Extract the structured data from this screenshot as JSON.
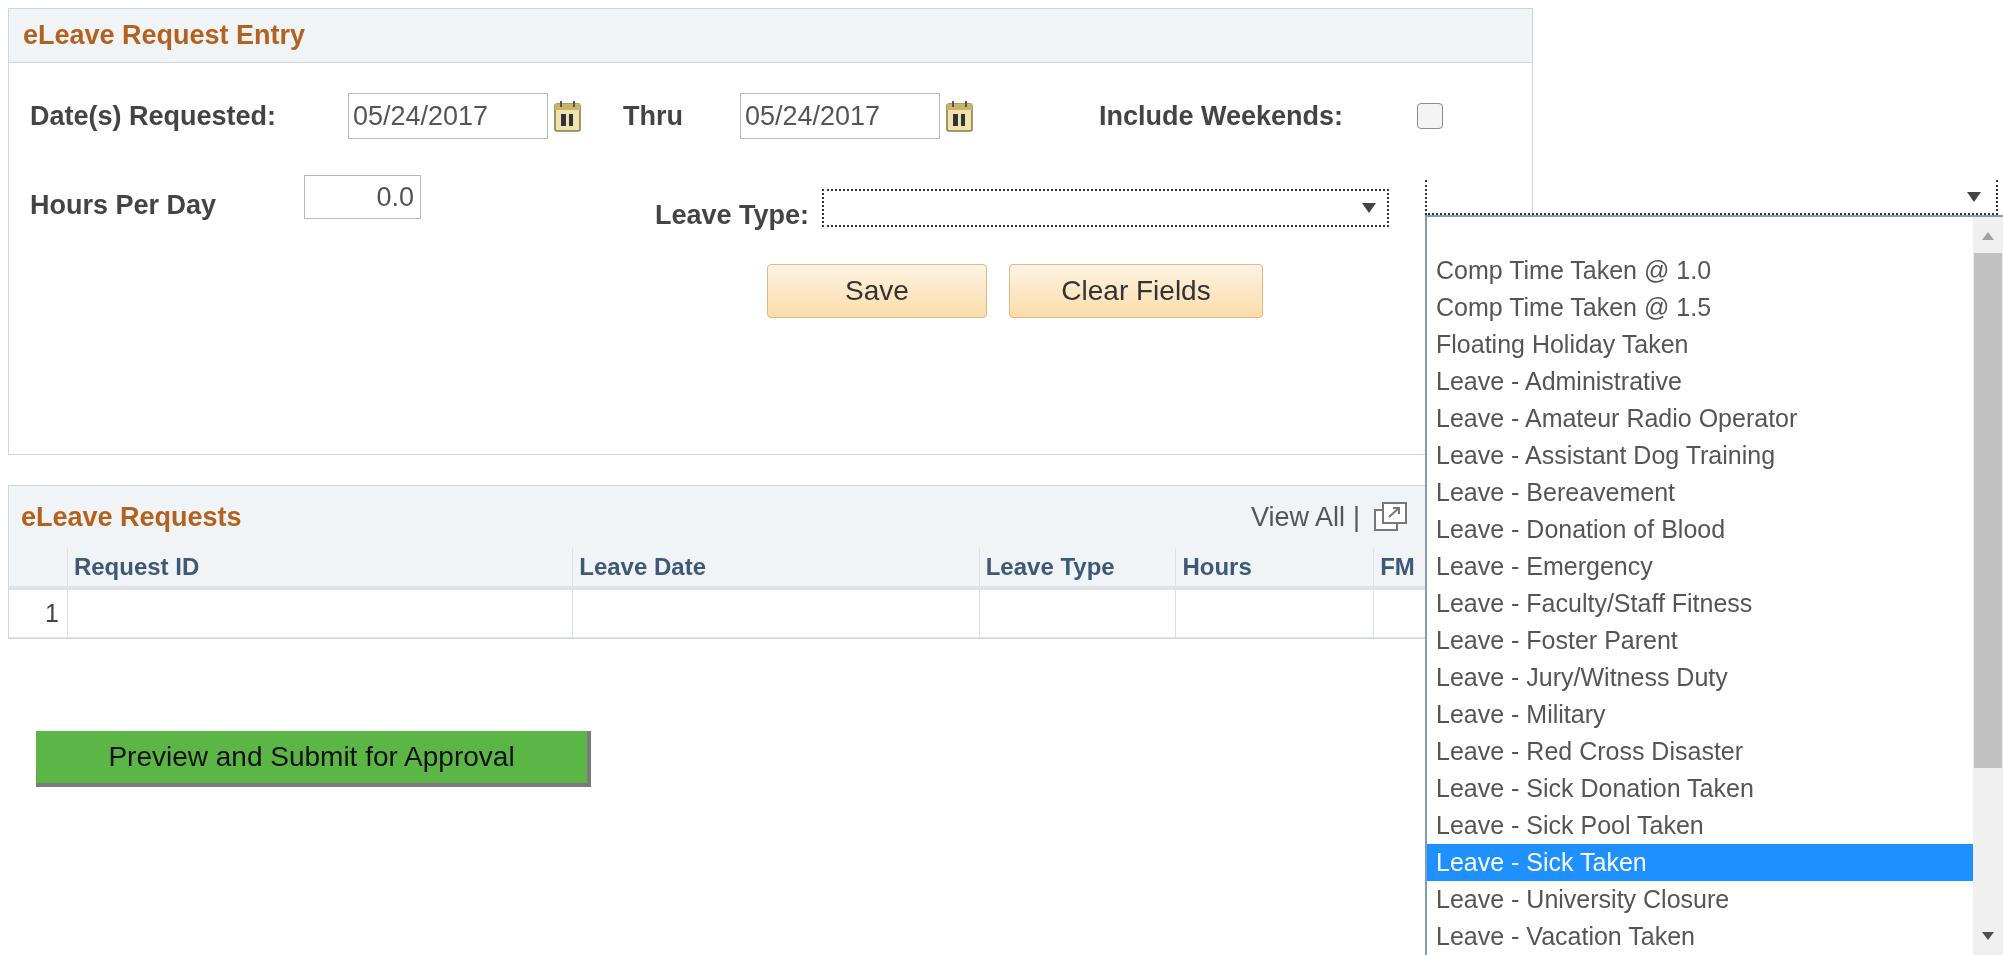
{
  "entry_panel": {
    "title": "eLeave Request Entry",
    "dates_requested": {
      "label": "Date(s) Requested:",
      "value": "05/24/2017"
    },
    "thru": {
      "label": "Thru",
      "value": "05/24/2017"
    },
    "include_weekends": {
      "label": "Include Weekends:",
      "checked": false
    },
    "hours_per_day": {
      "label": "Hours Per Day",
      "value": "0.0"
    },
    "leave_type": {
      "label": "Leave Type:",
      "expanded": true,
      "options": [
        {
          "label": "Comp Time Taken @ 1.0",
          "selected": false
        },
        {
          "label": "Comp Time Taken @ 1.5",
          "selected": false
        },
        {
          "label": "Floating Holiday Taken",
          "selected": false
        },
        {
          "label": "Leave - Administrative",
          "selected": false
        },
        {
          "label": "Leave - Amateur Radio Operator",
          "selected": false
        },
        {
          "label": "Leave - Assistant Dog Training",
          "selected": false
        },
        {
          "label": "Leave - Bereavement",
          "selected": false
        },
        {
          "label": "Leave - Donation of Blood",
          "selected": false
        },
        {
          "label": "Leave - Emergency",
          "selected": false
        },
        {
          "label": "Leave - Faculty/Staff Fitness",
          "selected": false
        },
        {
          "label": "Leave - Foster Parent",
          "selected": false
        },
        {
          "label": "Leave - Jury/Witness Duty",
          "selected": false
        },
        {
          "label": "Leave - Military",
          "selected": false
        },
        {
          "label": "Leave - Red Cross Disaster",
          "selected": false
        },
        {
          "label": "Leave - Sick Donation Taken",
          "selected": false
        },
        {
          "label": "Leave - Sick Pool Taken",
          "selected": false
        },
        {
          "label": "Leave - Sick Taken",
          "selected": true
        },
        {
          "label": "Leave - University Closure",
          "selected": false
        },
        {
          "label": "Leave - Vacation Taken",
          "selected": false
        }
      ]
    },
    "buttons": [
      "Save",
      "Clear Fields"
    ]
  },
  "requests_panel": {
    "title": "eLeave Requests",
    "view_all": "View All",
    "separator": "|",
    "columns": [
      "Request ID",
      "Leave Date",
      "Leave Type",
      "Hours",
      "FM"
    ],
    "rows": [
      {
        "number": "1"
      }
    ]
  },
  "submit_button": "Preview and Submit for Approval"
}
